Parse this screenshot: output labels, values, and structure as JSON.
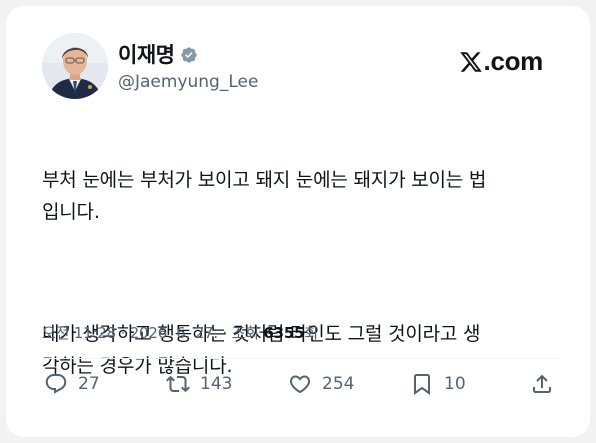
{
  "author": {
    "name": "이재명",
    "handle": "@Jaemyung_Lee",
    "verified": true
  },
  "brand": {
    "site": ".com",
    "logo_icon": "x-logo-icon"
  },
  "tweet": {
    "paragraph1": "부처 눈에는 부처가 보이고 돼지 눈에는 돼지가 보이는 법\n입니다.",
    "paragraph2": "내가 생각하고 행동하는 것처럼 타인도 그럴 것이라고 생\n각하는 경우가 많습니다."
  },
  "meta": {
    "timestamp": "오전 11:28 · 2026. 6. 27. · 조회 ",
    "views": "6355",
    "views_suffix": "회"
  },
  "actions": {
    "replies": "27",
    "retweets": "143",
    "likes": "254",
    "bookmarks": "10"
  },
  "colors": {
    "text": "#0f1419",
    "secondary": "#536471",
    "verified_badge": "#829aab"
  }
}
